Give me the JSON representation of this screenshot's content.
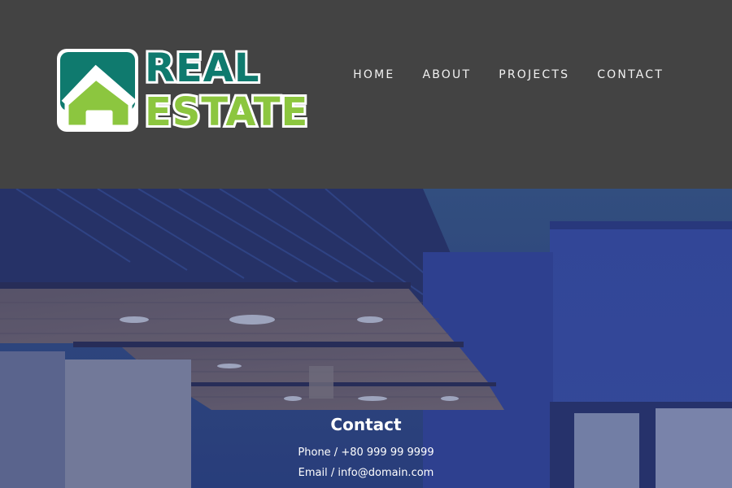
{
  "logo": {
    "line1": "REAL",
    "line2": "ESTATE",
    "colors": {
      "teal": "#0f7a6e",
      "green": "#8cc63f",
      "outline": "#ffffff"
    },
    "icon": "house-icon"
  },
  "nav": {
    "items": [
      {
        "label": "HOME"
      },
      {
        "label": "ABOUT"
      },
      {
        "label": "PROJECTS"
      },
      {
        "label": "CONTACT"
      }
    ]
  },
  "contact": {
    "title": "Contact",
    "phone": "Phone / +80 999 99 9999",
    "email": "Email / info@domain.com"
  },
  "colors": {
    "header_bg": "#434343",
    "hero_tint": "#2f428c"
  }
}
